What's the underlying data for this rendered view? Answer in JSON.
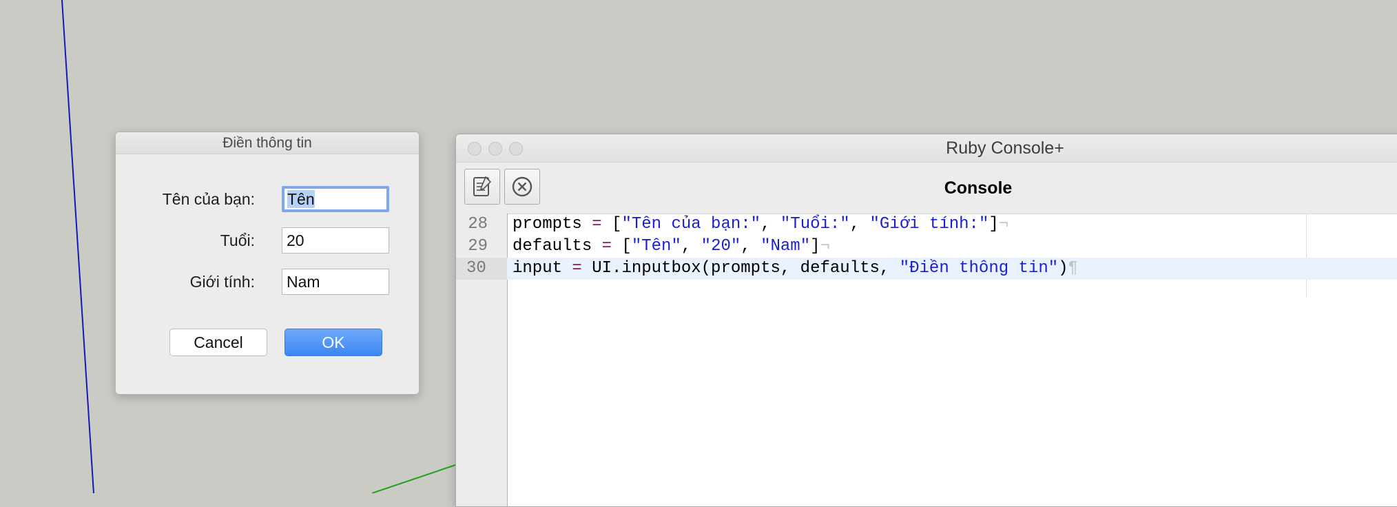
{
  "dialog": {
    "title": "Điền thông tin",
    "fields": [
      {
        "label": "Tên của bạn:",
        "value": "Tên"
      },
      {
        "label": "Tuổi:",
        "value": "20"
      },
      {
        "label": "Giới tính:",
        "value": "Nam"
      }
    ],
    "cancel_label": "Cancel",
    "ok_label": "OK"
  },
  "console": {
    "window_title": "Ruby Console+",
    "toolbar_title": "Console",
    "toolbar_icons": [
      "edit-script-icon",
      "clear-console-icon"
    ],
    "lines": [
      {
        "number": "28",
        "code": "prompts = [\"Tên của bạn:\", \"Tuổi:\", \"Giới tính:\"]",
        "end_mark": "¬"
      },
      {
        "number": "29",
        "code": "defaults = [\"Tên\", \"20\", \"Nam\"]",
        "end_mark": "¬"
      },
      {
        "number": "30",
        "code": "input = UI.inputbox(prompts, defaults, \"Điền thông tin\")",
        "end_mark": "¶"
      }
    ]
  },
  "colors": {
    "viewport_background": "#cbcbc6",
    "axis_blue": "#1616c0",
    "axis_green": "#1ca31c",
    "ok_button": "#3a86f3",
    "string_literal": "#1a1fd3",
    "operator": "#8a1b5a"
  }
}
